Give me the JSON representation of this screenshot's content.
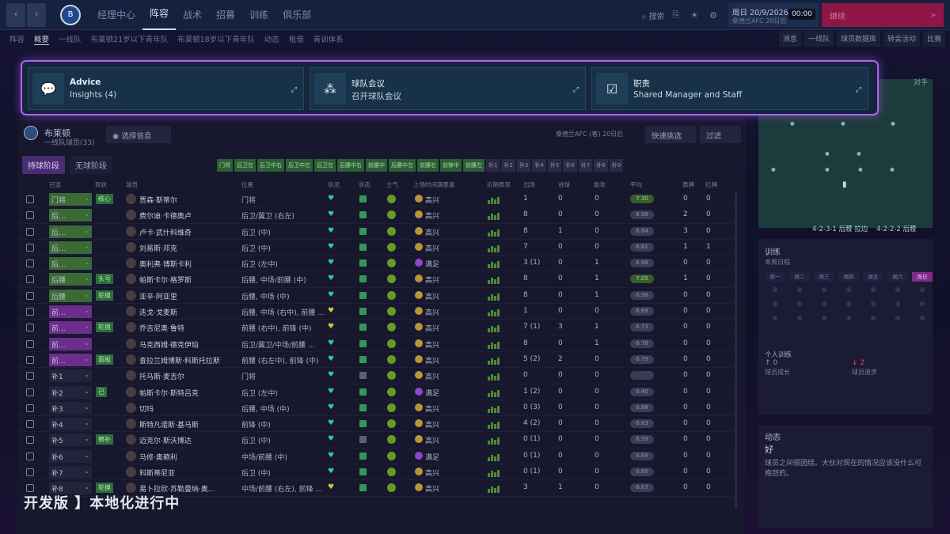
{
  "topbar": {
    "back": "‹",
    "forward": "›",
    "nav": [
      "经理中心",
      "阵容",
      "战术",
      "招募",
      "训练",
      "俱乐部"
    ],
    "search": "搜索",
    "date": "周日 20/9/2026",
    "date_sub": "桑德兰AFC 20日后",
    "time": "00:00",
    "continue_label": "继续"
  },
  "subnav": {
    "items": [
      "阵容",
      "概要",
      "一线队",
      "布莱顿21岁以下青年队",
      "布莱顿18岁以下青年队",
      "动态",
      "租借",
      "青训体系"
    ],
    "right": [
      "消息",
      "一线队",
      "球员数据库",
      "转会活动",
      "比赛"
    ]
  },
  "overlay": {
    "cards": [
      {
        "title": "Advice",
        "subtitle": "Insights (4)",
        "icon": "chat-icon"
      },
      {
        "title": "球队会议",
        "subtitle": "召开球队会议",
        "icon": "meeting-icon"
      },
      {
        "title": "职责",
        "subtitle": "Shared    Manager and Staff",
        "icon": "staff-icon"
      }
    ]
  },
  "squad": {
    "club": "布莱顿",
    "club_sub": "一线队球员(33)",
    "select_info": "选择信息",
    "next_match": "桑德兰AFC (客) 20日后",
    "quick_pick": "快速挑选",
    "filter": "过滤",
    "phase_in": "持球阶段",
    "phase_out": "无球阶段",
    "pos_chips": [
      "门将",
      "后卫左",
      "后卫中右",
      "后卫中左",
      "后卫左",
      "后腰中右",
      "前腰中",
      "后腰中左",
      "前腰右",
      "前锋中",
      "前腰左",
      "补1",
      "补2",
      "补3",
      "补4",
      "补5",
      "补6",
      "补7",
      "补8",
      "补9"
    ],
    "headers": [
      "已选",
      "现状",
      "球员",
      "位置",
      "状况",
      "状态",
      "士气",
      "上场时间满意度",
      "近期表现",
      "出场",
      "进球",
      "助攻",
      "平均",
      "黄牌",
      "红牌"
    ],
    "rows": [
      {
        "sel": "门将",
        "tag": "核心",
        "name": "贾森·斯蒂尔",
        "pos": "门将",
        "mood": "高兴",
        "apps": "1",
        "goals": "0",
        "ast": "0",
        "rating": "7.30",
        "yc": "0",
        "rc": "0"
      },
      {
        "sel": "后...",
        "tag": "",
        "name": "费尔迪·卡德奥卢",
        "pos": "后卫/翼卫 (右左)",
        "mood": "高兴",
        "apps": "8",
        "goals": "0",
        "ast": "0",
        "rating": "6.98",
        "yc": "2",
        "rc": "0"
      },
      {
        "sel": "后...",
        "tag": "",
        "name": "卢卡·武什科维奇",
        "pos": "后卫 (中)",
        "mood": "高兴",
        "apps": "8",
        "goals": "1",
        "ast": "0",
        "rating": "6.84",
        "yc": "3",
        "rc": "0"
      },
      {
        "sel": "后...",
        "tag": "",
        "name": "刘易斯·邓克",
        "pos": "后卫 (中)",
        "mood": "高兴",
        "apps": "7",
        "goals": "0",
        "ast": "0",
        "rating": "6.61",
        "yc": "1",
        "rc": "1"
      },
      {
        "sel": "后...",
        "tag": "",
        "name": "奥利弗·博斯卡利",
        "pos": "后卫 (左中)",
        "mood": "满足",
        "apps": "3 (1)",
        "goals": "0",
        "ast": "1",
        "rating": "6.98",
        "yc": "0",
        "rc": "0"
      },
      {
        "sel": "后腰",
        "tag": "头号",
        "name": "帕斯卡尔·格罗斯",
        "pos": "后腰, 中场/前腰 (中)",
        "mood": "高兴",
        "apps": "8",
        "goals": "0",
        "ast": "1",
        "rating": "7.05",
        "yc": "1",
        "rc": "0"
      },
      {
        "sel": "后腰",
        "tag": "轮换",
        "name": "亚辛·阿亚里",
        "pos": "后腰, 中场 (中)",
        "mood": "高兴",
        "apps": "8",
        "goals": "0",
        "ast": "1",
        "rating": "6.98",
        "yc": "0",
        "rc": "0"
      },
      {
        "sel": "前...",
        "tag": "",
        "name": "迭戈·戈麦斯",
        "pos": "后腰, 中场 (右中), 前腰 ...",
        "mood": "高兴",
        "apps": "1",
        "goals": "0",
        "ast": "0",
        "rating": "6.69",
        "yc": "0",
        "rc": "0"
      },
      {
        "sel": "前...",
        "tag": "轮换",
        "name": "乔吉尼奥·鲁特",
        "pos": "前腰 (右中), 前锋 (中)",
        "mood": "高兴",
        "apps": "7 (1)",
        "goals": "3",
        "ast": "1",
        "rating": "6.73",
        "yc": "0",
        "rc": "0"
      },
      {
        "sel": "前...",
        "tag": "",
        "name": "马克西姆·德克伊珀",
        "pos": "后卫/翼卫/中场/前腰 ...",
        "mood": "高兴",
        "apps": "8",
        "goals": "0",
        "ast": "1",
        "rating": "6.78",
        "yc": "0",
        "rc": "0"
      },
      {
        "sel": "前...",
        "tag": "面板",
        "name": "查拉兰姆博斯·科斯托拉斯",
        "pos": "前腰 (右左中), 前锋 (中)",
        "mood": "高兴",
        "apps": "5 (2)",
        "goals": "2",
        "ast": "0",
        "rating": "6.79",
        "yc": "0",
        "rc": "0"
      },
      {
        "sel": "补1",
        "tag": "",
        "name": "托马斯·麦吉尔",
        "pos": "门将",
        "mood": "高兴",
        "apps": "0",
        "goals": "0",
        "ast": "0",
        "rating": "",
        "yc": "0",
        "rc": "0"
      },
      {
        "sel": "补2",
        "tag": "已",
        "name": "帕斯卡尔·斯特吕克",
        "pos": "后卫 (左中)",
        "mood": "满足",
        "apps": "1 (2)",
        "goals": "0",
        "ast": "0",
        "rating": "6.40",
        "yc": "0",
        "rc": "0"
      },
      {
        "sel": "补3",
        "tag": "",
        "name": "切玛",
        "pos": "后腰, 中场 (中)",
        "mood": "高兴",
        "apps": "0 (3)",
        "goals": "0",
        "ast": "0",
        "rating": "6.68",
        "yc": "0",
        "rc": "0"
      },
      {
        "sel": "补4",
        "tag": "",
        "name": "斯特凡诺斯·基马斯",
        "pos": "前锋 (中)",
        "mood": "高兴",
        "apps": "4 (2)",
        "goals": "0",
        "ast": "0",
        "rating": "6.63",
        "yc": "0",
        "rc": "0"
      },
      {
        "sel": "补5",
        "tag": "替补",
        "name": "迈克尔·斯沃博达",
        "pos": "后卫 (中)",
        "mood": "高兴",
        "apps": "0 (1)",
        "goals": "0",
        "ast": "0",
        "rating": "6.59",
        "yc": "0",
        "rc": "0"
      },
      {
        "sel": "补6",
        "tag": "",
        "name": "马修·奥赖利",
        "pos": "中场/前腰 (中)",
        "mood": "满足",
        "apps": "0 (1)",
        "goals": "0",
        "ast": "0",
        "rating": "6.69",
        "yc": "0",
        "rc": "0"
      },
      {
        "sel": "补7",
        "tag": "",
        "name": "科斯蒂尼亚",
        "pos": "后卫 (中)",
        "mood": "高兴",
        "apps": "0 (1)",
        "goals": "0",
        "ast": "0",
        "rating": "6.60",
        "yc": "0",
        "rc": "0"
      },
      {
        "sel": "补8",
        "tag": "轮换",
        "name": "易卜拉欣·苏勒曼纳·奥...",
        "pos": "中场/前腰 (右左), 前锋 ...",
        "mood": "高兴",
        "apps": "3",
        "goals": "1",
        "ast": "0",
        "rating": "6.67",
        "yc": "0",
        "rc": "0"
      }
    ]
  },
  "tactics": {
    "formation1": "4-2-3-1 后腰 拉边",
    "formation2": "4-2-2-2 后腰",
    "opponent": "对手"
  },
  "training": {
    "title": "训练",
    "week": "本周日程",
    "days": [
      "周一",
      "周二",
      "周三",
      "周四",
      "周五",
      "周六",
      "周日"
    ],
    "personal": "个人训练",
    "up": "0",
    "down": "2",
    "up_label": "球员成长",
    "down_label": "球员退步"
  },
  "dynamics": {
    "title": "动态",
    "value": "好",
    "text": "球员之间很团结。大伙对现在的情况应该没什么可抱怨的。"
  },
  "watermark": "开发版 】本地化进行中"
}
